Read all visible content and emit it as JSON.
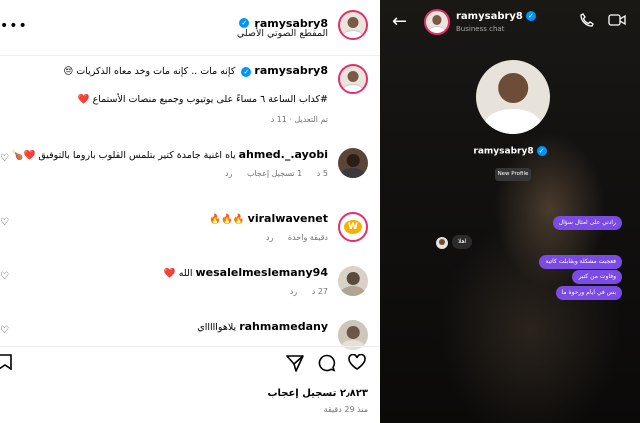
{
  "post": {
    "author": "ramysabry8",
    "audio_label": "المقطع الصوتي الأصلي",
    "caption_line1": "كإنه مات .. كإنه مات وخد معاه الذكريات 😔",
    "caption_line2": "#كداب الساعة ٦ مساءً على يوتيوب وجميع منصات الأستماع ❤️",
    "edited_meta": "تم التعديل · 11 د",
    "comments": [
      {
        "user": "ahmed._.ayobi",
        "text": "ياه اغنية جامدة كتير بتلمس القلوب باروما بالتوفيق ❤️🍗",
        "time": "5 د",
        "likes": "1 تسجيل إعجاب",
        "reply": "رد"
      },
      {
        "user": "viralwavenet",
        "text": "🔥🔥🔥",
        "time": "دقيقة واحدة",
        "reply": "رد"
      },
      {
        "user": "wesalelmeslemany94",
        "text": "الله ❤️",
        "time": "27 د",
        "reply": "رد"
      },
      {
        "user": "rahmamedany",
        "text": "يلاهواااااي"
      }
    ],
    "likes_count": "٢٫٨٢٣ تسجيل إعجاب",
    "time_ago": "منذ 29 دقيقة"
  },
  "chat": {
    "username": "ramysabry8",
    "subtitle": "Business chat",
    "profile_name": "ramysabry8",
    "new_profile_badge": "New Profile",
    "messages": [
      {
        "dir": "out",
        "text": "رادني على امثال سؤال"
      },
      {
        "dir": "in",
        "text": "اهلا"
      },
      {
        "dir": "out",
        "text": "فعجبت مشكلة وبقابلت كاتية"
      },
      {
        "dir": "out",
        "text": "وفاوت من كتير"
      },
      {
        "dir": "out",
        "text": "بس في ايام ورحوة ما"
      }
    ]
  },
  "icons": {
    "more": "more-dots-icon",
    "heart": "heart-icon",
    "comment": "comment-icon",
    "share": "share-icon",
    "save": "bookmark-icon",
    "back": "back-arrow-icon",
    "call": "phone-icon",
    "video": "video-icon"
  },
  "colors": {
    "accent": "#7b4ce3",
    "verified": "#0095f6",
    "story_ring": "#e1306c",
    "heart_red": "#ed4956"
  }
}
